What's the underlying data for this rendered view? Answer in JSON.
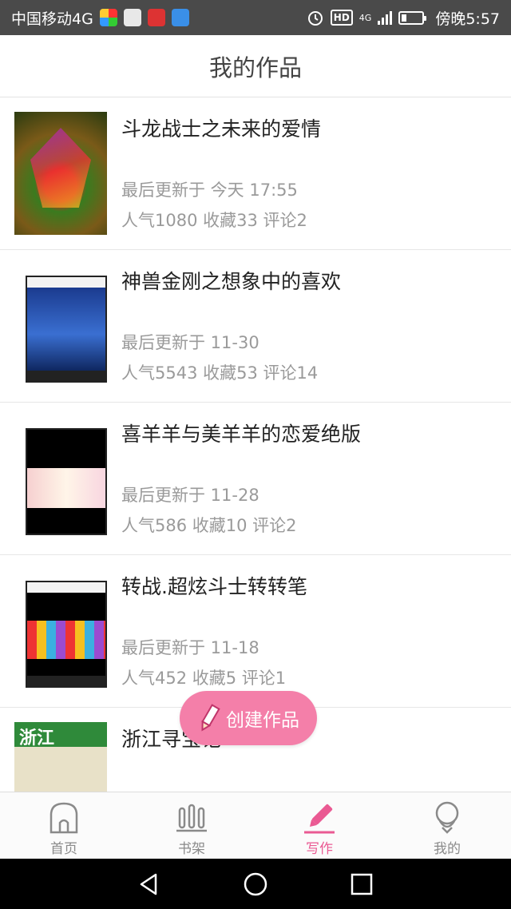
{
  "status_bar": {
    "carrier": "中国移动4G",
    "hd": "HD",
    "network": "4G",
    "time_label": "傍晚5:57"
  },
  "header": {
    "title": "我的作品"
  },
  "works": [
    {
      "title": "斗龙战士之未来的爱情",
      "updated": "最后更新于 今天 17:55",
      "stats": "人气1080 收藏33 评论2"
    },
    {
      "title": "神兽金刚之想象中的喜欢",
      "updated": "最后更新于 11-30",
      "stats": "人气5543 收藏53 评论14"
    },
    {
      "title": "喜羊羊与美羊羊的恋爱绝版",
      "updated": "最后更新于 11-28",
      "stats": "人气586 收藏10 评论2"
    },
    {
      "title": "转战.超炫斗士转转笔",
      "updated": "最后更新于 11-18",
      "stats": "人气452 收藏5 评论1"
    },
    {
      "title": "浙江寻宝记",
      "updated": "",
      "stats": ""
    }
  ],
  "fab": {
    "label": "创建作品"
  },
  "tabs": [
    {
      "label": "首页",
      "icon": "home-icon"
    },
    {
      "label": "书架",
      "icon": "bookshelf-icon"
    },
    {
      "label": "写作",
      "icon": "pen-icon"
    },
    {
      "label": "我的",
      "icon": "profile-icon"
    }
  ],
  "active_tab": "写作",
  "colors": {
    "accent": "#ea5a93",
    "fab": "#f47fa9",
    "status_bar": "#4a4a4a"
  }
}
